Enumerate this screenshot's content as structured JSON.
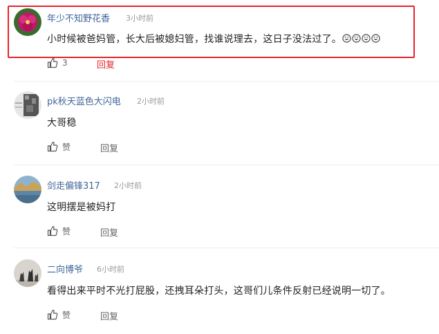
{
  "comments": [
    {
      "username": "年少不知野花香",
      "time": "3小时前",
      "text": "小时候被爸妈管，长大后被媳妇管，找谁说理去，这日子没法过了。",
      "emoji": [
        "grin-emoji",
        "grin-emoji",
        "grin-emoji",
        "grin-emoji"
      ],
      "like_count": "3",
      "reply_label": "回复"
    },
    {
      "username": "pk秋天蓝色大闪电",
      "time": "2小时前",
      "text": "大哥稳",
      "like_count": "赞",
      "reply_label": "回复"
    },
    {
      "username": "剑走偏锋317",
      "time": "2小时前",
      "text": "这明摆是被妈打",
      "like_count": "赞",
      "reply_label": "回复"
    },
    {
      "username": "二向博爷",
      "time": "6小时前",
      "text": "看得出来平时不光打屁股，还拽耳朵打头，这哥们儿条件反射已经说明一切了。",
      "like_count": "赞",
      "reply_label": "回复"
    }
  ],
  "colors": {
    "username": "#406599",
    "highlight_border": "#e8222a",
    "accent_reply": "#e8222a",
    "muted": "#999999"
  },
  "icons": {
    "like": "thumbs-up-icon"
  }
}
